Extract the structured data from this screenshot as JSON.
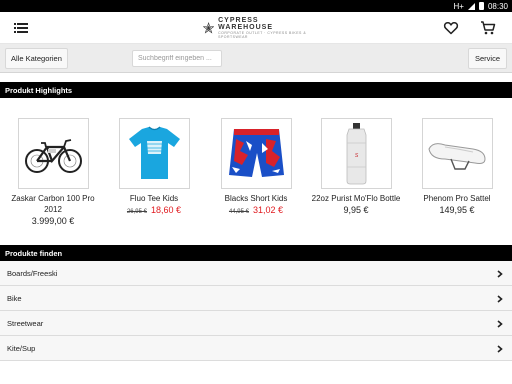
{
  "status_bar": {
    "network": "H+",
    "time": "08:30"
  },
  "header": {
    "logo_main": "CYPRESS WAREHOUSE",
    "logo_sub": "CORPORATE OUTLET · CYPRESS BIKES & SPORTSWEAR",
    "icons": [
      "menu-icon",
      "heart-icon",
      "cart-icon"
    ]
  },
  "toolbar": {
    "categories_label": "Alle Kategorien",
    "search_placeholder": "Suchbegriff eingeben ...",
    "service_label": "Service"
  },
  "highlights": {
    "title": "Produkt Highlights",
    "products": [
      {
        "name": "Zaskar Carbon 100 Pro 2012",
        "price": "3.999,00 €",
        "old_price": "",
        "image": "bike"
      },
      {
        "name": "Fluo Tee Kids",
        "price": "18,60 €",
        "old_price": "26,95 €",
        "image": "tshirt"
      },
      {
        "name": "Blacks Short Kids",
        "price": "31,02 €",
        "old_price": "44,95 €",
        "image": "shorts"
      },
      {
        "name": "22oz Purist Mo'Flo Bottle",
        "price": "9,95 €",
        "old_price": "",
        "image": "bottle"
      },
      {
        "name": "Phenom Pro Sattel",
        "price": "149,95 €",
        "old_price": "",
        "image": "saddle"
      }
    ]
  },
  "finder": {
    "title": "Produkte finden",
    "categories": [
      "Boards/Freeski",
      "Bike",
      "Streetwear",
      "Kite/Sup"
    ]
  },
  "colors": {
    "header_bg": "#000000",
    "sale_red": "#e0191e",
    "toolbar_bg": "#ececec"
  }
}
